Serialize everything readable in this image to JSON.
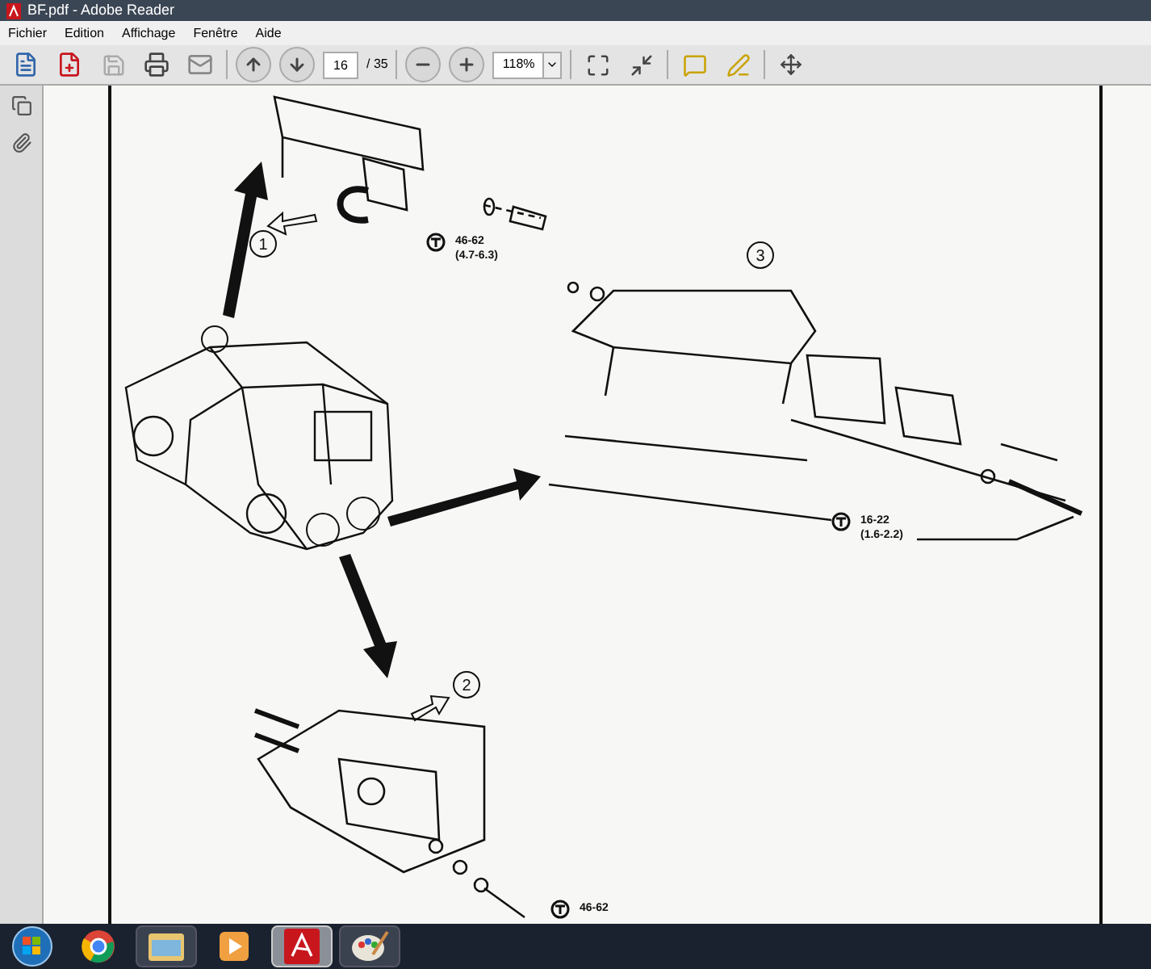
{
  "window": {
    "title": "BF.pdf - Adobe Reader"
  },
  "menu": [
    "Fichier",
    "Edition",
    "Affichage",
    "Fenêtre",
    "Aide"
  ],
  "toolbar": {
    "page_number": "16",
    "page_total": "/ 35",
    "zoom": "118%"
  },
  "document": {
    "callouts": [
      {
        "label": "1"
      },
      {
        "label": "3"
      },
      {
        "label": "2"
      }
    ],
    "torque_specs": [
      {
        "value": "46-62",
        "range": "(4.7-6.3)"
      },
      {
        "value": "16-22",
        "range": "(1.6-2.2)"
      },
      {
        "value": "46-62"
      }
    ]
  },
  "taskbar": [
    {
      "kind": "start",
      "selected": false
    },
    {
      "kind": "browser",
      "selected": false
    },
    {
      "kind": "folder",
      "selected": false
    },
    {
      "kind": "media",
      "selected": false
    },
    {
      "kind": "pdf",
      "selected": true
    },
    {
      "kind": "paint",
      "selected": false
    }
  ]
}
